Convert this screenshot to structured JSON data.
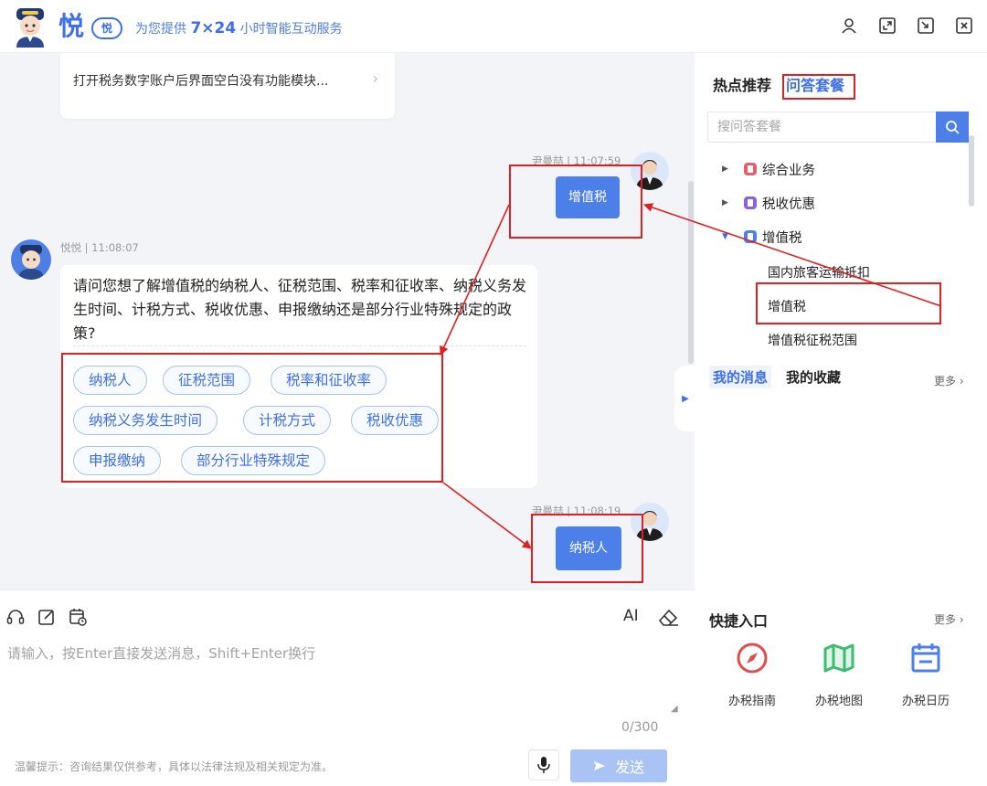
{
  "header": {
    "brand_char": "悦",
    "brand_badge": "悦",
    "slogan_prefix": "为您提供",
    "slogan_highlight": "7×24",
    "slogan_suffix": "小时智能互动服务",
    "window_icons": [
      "user-icon",
      "expand-icon",
      "minimize-icon",
      "close-icon"
    ]
  },
  "chat": {
    "previous_card_text": "打开税务数字账户后界面空白没有功能模块...",
    "messages": [
      {
        "role": "user",
        "meta": "尹曼喆 | 11:07:59",
        "text": "增值税"
      },
      {
        "role": "bot",
        "meta": "悦悦 | 11:08:07",
        "text": "请问您想了解增值税的纳税人、征税范围、税率和征收率、纳税义务发生时间、计税方式、税收优惠、申报缴纳还是部分行业特殊规定的政策?",
        "options": [
          "纳税人",
          "征税范围",
          "税率和征收率",
          "纳税义务发生时间",
          "计税方式",
          "税收优惠",
          "申报缴纳",
          "部分行业特殊规定"
        ]
      },
      {
        "role": "user",
        "meta": "尹曼喆 | 11:08:19",
        "text": "纳税人"
      }
    ]
  },
  "input": {
    "placeholder": "请输入，按Enter直接发送消息，Shift+Enter换行",
    "value": "",
    "counter": "0/300",
    "ai_label": "AI",
    "tip": "温馨提示：咨询结果仅供参考，具体以法律法规及相关规定为准。",
    "send_label": "发送",
    "tools": [
      "headset-icon",
      "edit-icon",
      "calendar-clock-icon"
    ]
  },
  "right_panel": {
    "tabs": [
      "热点推荐",
      "问答套餐"
    ],
    "active_tab": "问答套餐",
    "search_placeholder": "搜问答套餐",
    "tree": [
      {
        "label": "综合业务",
        "color": "#e0606e",
        "expanded": false
      },
      {
        "label": "税收优惠",
        "color": "#8a63d8",
        "expanded": false
      },
      {
        "label": "增值税",
        "color": "#4d7fe9",
        "expanded": true,
        "children": [
          "国内旅客运输抵扣",
          "增值税",
          "增值税征税范围"
        ]
      }
    ],
    "message_tabs": [
      "我的消息",
      "我的收藏"
    ],
    "more_label": "更多",
    "quick_title": "快捷入口",
    "quick_more_label": "更多",
    "quick_items": [
      {
        "label": "办税指南",
        "icon": "compass-icon",
        "color": "#e24d4d"
      },
      {
        "label": "办税地图",
        "icon": "map-icon",
        "color": "#3dbb72"
      },
      {
        "label": "办税日历",
        "icon": "calendar-icon",
        "color": "#4d7fe9"
      }
    ]
  }
}
